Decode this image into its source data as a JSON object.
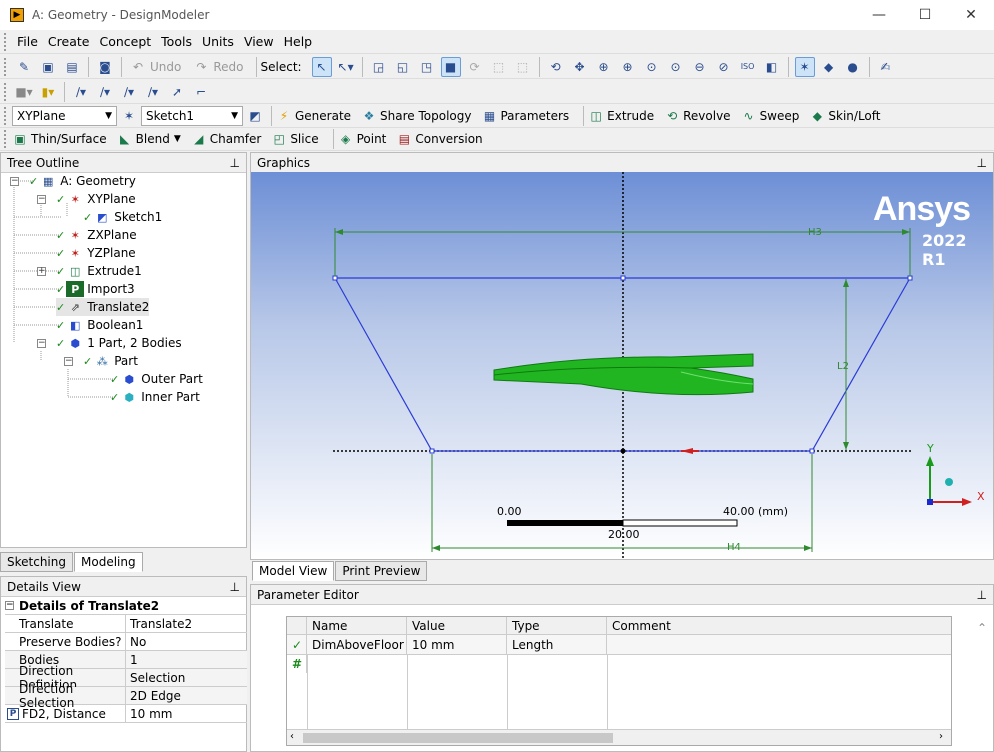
{
  "window": {
    "title": "A: Geometry - DesignModeler",
    "minimize": "—",
    "maximize": "☐",
    "close": "✕"
  },
  "menu": [
    "File",
    "Create",
    "Concept",
    "Tools",
    "Units",
    "View",
    "Help"
  ],
  "toolbar1": {
    "undo": "Undo",
    "redo": "Redo",
    "select": "Select:"
  },
  "toolbar3": {
    "plane": "XYPlane",
    "sketch": "Sketch1",
    "generate": "Generate",
    "share_topology": "Share Topology",
    "parameters": "Parameters",
    "extrude": "Extrude",
    "revolve": "Revolve",
    "sweep": "Sweep",
    "skin_loft": "Skin/Loft"
  },
  "toolbar4": {
    "thin_surface": "Thin/Surface",
    "blend": "Blend",
    "chamfer": "Chamfer",
    "slice": "Slice",
    "point": "Point",
    "conversion": "Conversion"
  },
  "tree": {
    "header": "Tree Outline",
    "pin": "⊞",
    "nodes": [
      "A: Geometry",
      "XYPlane",
      "Sketch1",
      "ZXPlane",
      "YZPlane",
      "Extrude1",
      "Import3",
      "Translate2",
      "Boolean1",
      "1 Part, 2 Bodies",
      "Part",
      "Outer Part",
      "Inner Part"
    ]
  },
  "left_tabs": {
    "sketching": "Sketching",
    "modeling": "Modeling"
  },
  "details": {
    "header": "Details View",
    "title": "Details of Translate2",
    "rows": [
      {
        "k": "Translate",
        "v": "Translate2"
      },
      {
        "k": "Preserve Bodies?",
        "v": "No"
      },
      {
        "k": "Bodies",
        "v": "1"
      },
      {
        "k": "Direction Definition",
        "v": "Selection"
      },
      {
        "k": "Direction Selection",
        "v": "2D Edge"
      },
      {
        "k": "FD2, Distance",
        "v": "10 mm"
      }
    ],
    "param_badge": "P"
  },
  "graphics": {
    "header": "Graphics",
    "brand": "Ansys",
    "version": "2022 R1",
    "dims": {
      "h3": "H3",
      "l2": "L2",
      "h4": "H4"
    },
    "scale": {
      "left": "0.00",
      "mid": "20.00",
      "right": "40.00 (mm)"
    },
    "axes": {
      "x": "X",
      "y": "Y"
    }
  },
  "view_tabs": {
    "model_view": "Model View",
    "print_preview": "Print Preview"
  },
  "param_editor": {
    "header": "Parameter Editor",
    "columns": [
      "Name",
      "Value",
      "Type",
      "Comment"
    ],
    "rows": [
      {
        "name": "DimAboveFloor",
        "value": "10 mm",
        "type": "Length",
        "comment": ""
      }
    ],
    "new_row_marker": "#"
  }
}
